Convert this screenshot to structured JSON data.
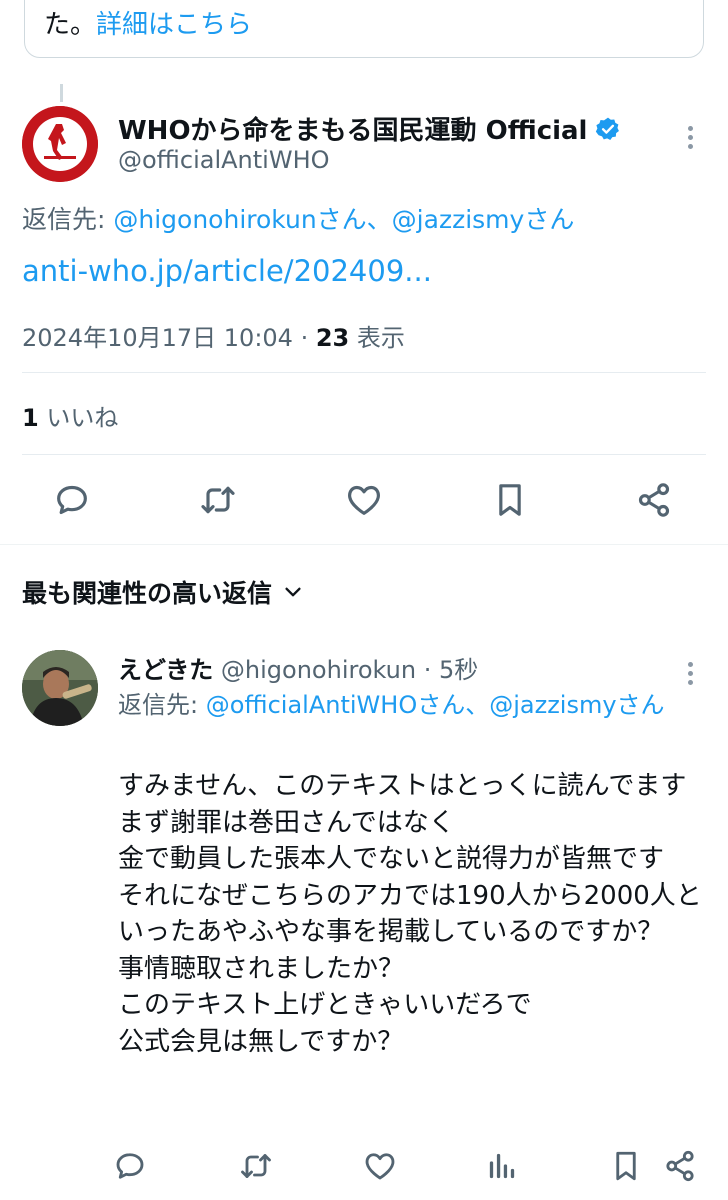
{
  "quoted_card": {
    "text_prefix": "た。",
    "link_text": "詳細はこちら"
  },
  "main_tweet": {
    "display_name": "WHOから命をまもる国民運動 Official",
    "handle": "@officialAntiWHO",
    "reply_to_label": "返信先: ",
    "reply_to_users": "@higonohirokunさん、@jazzismyさん",
    "link": "anti-who.jp/article/202409...",
    "timestamp": "2024年10月17日 10:04",
    "separator": " · ",
    "views_count": "23",
    "views_label": " 表示",
    "likes_count": "1",
    "likes_label": " いいね"
  },
  "sort": {
    "label": "最も関連性の高い返信"
  },
  "reply": {
    "display_name": "えどきた",
    "handle": "@higonohirokun",
    "time": " · 5秒",
    "reply_to_label": "返信先: ",
    "reply_to_users": "@officialAntiWHOさん、@jazzismyさん",
    "body": "すみません、このテキストはとっくに読んでます\nまず謝罪は巻田さんではなく\n金で動員した張本人でないと説得力が皆無です\nそれになぜこちらのアカでは190人から2000人といったあやふやな事を掲載しているのですか？\n事情聴取されましたか？\nこのテキスト上げときゃいいだろで\n公式会見は無しですか？"
  },
  "icons": {
    "more": "more-horizontal-icon",
    "reply": "reply-icon",
    "retweet": "retweet-icon",
    "like": "heart-icon",
    "bookmark": "bookmark-icon",
    "share": "share-icon",
    "views": "analytics-icon",
    "verified": "verified-badge-icon",
    "chevron": "chevron-down-icon"
  },
  "colors": {
    "accent": "#1d9bf0",
    "secondary_text": "#536471",
    "logo_red": "#c4161c"
  }
}
